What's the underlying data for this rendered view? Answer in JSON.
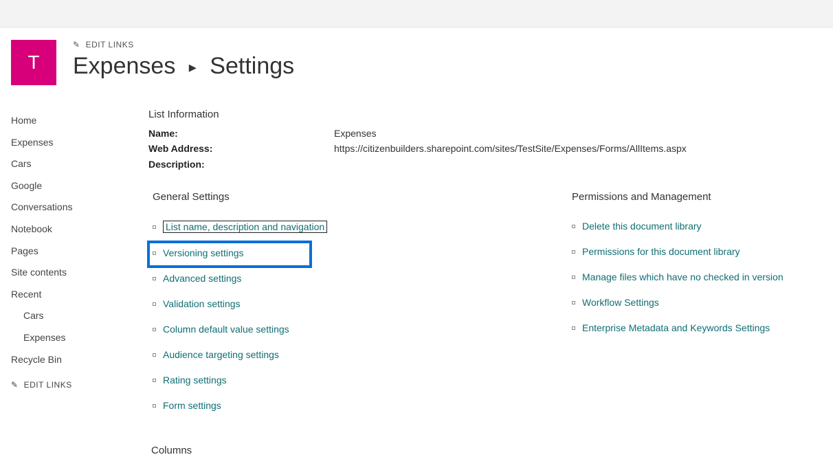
{
  "topEditLinks": "EDIT LINKS",
  "siteTile": "T",
  "breadcrumb": {
    "site": "Expenses",
    "page": "Settings"
  },
  "nav": {
    "items": [
      {
        "label": "Home",
        "indent": false
      },
      {
        "label": "Expenses",
        "indent": false
      },
      {
        "label": "Cars",
        "indent": false
      },
      {
        "label": "Google",
        "indent": false
      },
      {
        "label": "Conversations",
        "indent": false
      },
      {
        "label": "Notebook",
        "indent": false
      },
      {
        "label": "Pages",
        "indent": false
      },
      {
        "label": "Site contents",
        "indent": false
      },
      {
        "label": "Recent",
        "indent": false
      },
      {
        "label": "Cars",
        "indent": true
      },
      {
        "label": "Expenses",
        "indent": true
      },
      {
        "label": "Recycle Bin",
        "indent": false
      }
    ],
    "editLinks": "EDIT LINKS"
  },
  "listInfo": {
    "heading": "List Information",
    "rows": [
      {
        "label": "Name:",
        "value": "Expenses"
      },
      {
        "label": "Web Address:",
        "value": "https://citizenbuilders.sharepoint.com/sites/TestSite/Expenses/Forms/AllItems.aspx"
      },
      {
        "label": "Description:",
        "value": ""
      }
    ]
  },
  "generalSettings": {
    "heading": "General Settings",
    "links": [
      {
        "label": "List name, description and navigation",
        "focused": true,
        "highlighted": false
      },
      {
        "label": "Versioning settings",
        "focused": false,
        "highlighted": true
      },
      {
        "label": "Advanced settings",
        "focused": false,
        "highlighted": false
      },
      {
        "label": "Validation settings",
        "focused": false,
        "highlighted": false
      },
      {
        "label": "Column default value settings",
        "focused": false,
        "highlighted": false
      },
      {
        "label": "Audience targeting settings",
        "focused": false,
        "highlighted": false
      },
      {
        "label": "Rating settings",
        "focused": false,
        "highlighted": false
      },
      {
        "label": "Form settings",
        "focused": false,
        "highlighted": false
      }
    ]
  },
  "permissionsManagement": {
    "heading": "Permissions and Management",
    "links": [
      {
        "label": "Delete this document library"
      },
      {
        "label": "Permissions for this document library"
      },
      {
        "label": "Manage files which have no checked in version"
      },
      {
        "label": "Workflow Settings"
      },
      {
        "label": "Enterprise Metadata and Keywords Settings"
      }
    ]
  },
  "columnsHeading": "Columns"
}
